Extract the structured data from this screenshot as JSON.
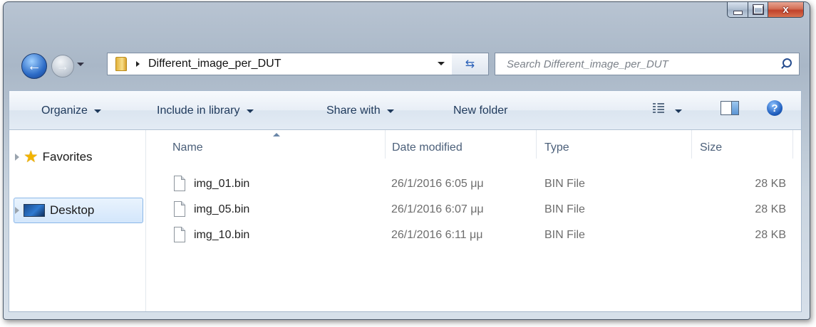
{
  "window": {
    "controls": {
      "minimize_icon": "minimize-icon",
      "maximize_icon": "maximize-icon",
      "close_glyph": "x"
    }
  },
  "address_bar": {
    "path": "Different_image_per_DUT",
    "refresh_glyph": "⇆",
    "search_placeholder": "Search Different_image_per_DUT"
  },
  "toolbar": {
    "organize": "Organize",
    "include_in_library": "Include in library",
    "share_with": "Share with",
    "new_folder": "New folder",
    "help_glyph": "?"
  },
  "nav_pane": {
    "favorites": "Favorites",
    "desktop": "Desktop"
  },
  "columns": {
    "name": "Name",
    "date_modified": "Date modified",
    "type": "Type",
    "size": "Size"
  },
  "files": [
    {
      "name": "img_01.bin",
      "date": "26/1/2016 6:05 μμ",
      "type": "BIN File",
      "size": "28 KB"
    },
    {
      "name": "img_05.bin",
      "date": "26/1/2016 6:07 μμ",
      "type": "BIN File",
      "size": "28 KB"
    },
    {
      "name": "img_10.bin",
      "date": "26/1/2016 6:11 μμ",
      "type": "BIN File",
      "size": "28 KB"
    }
  ],
  "colors": {
    "accent": "#1e395b",
    "selection": "#d3e6fb",
    "close_button": "#c0412a"
  }
}
